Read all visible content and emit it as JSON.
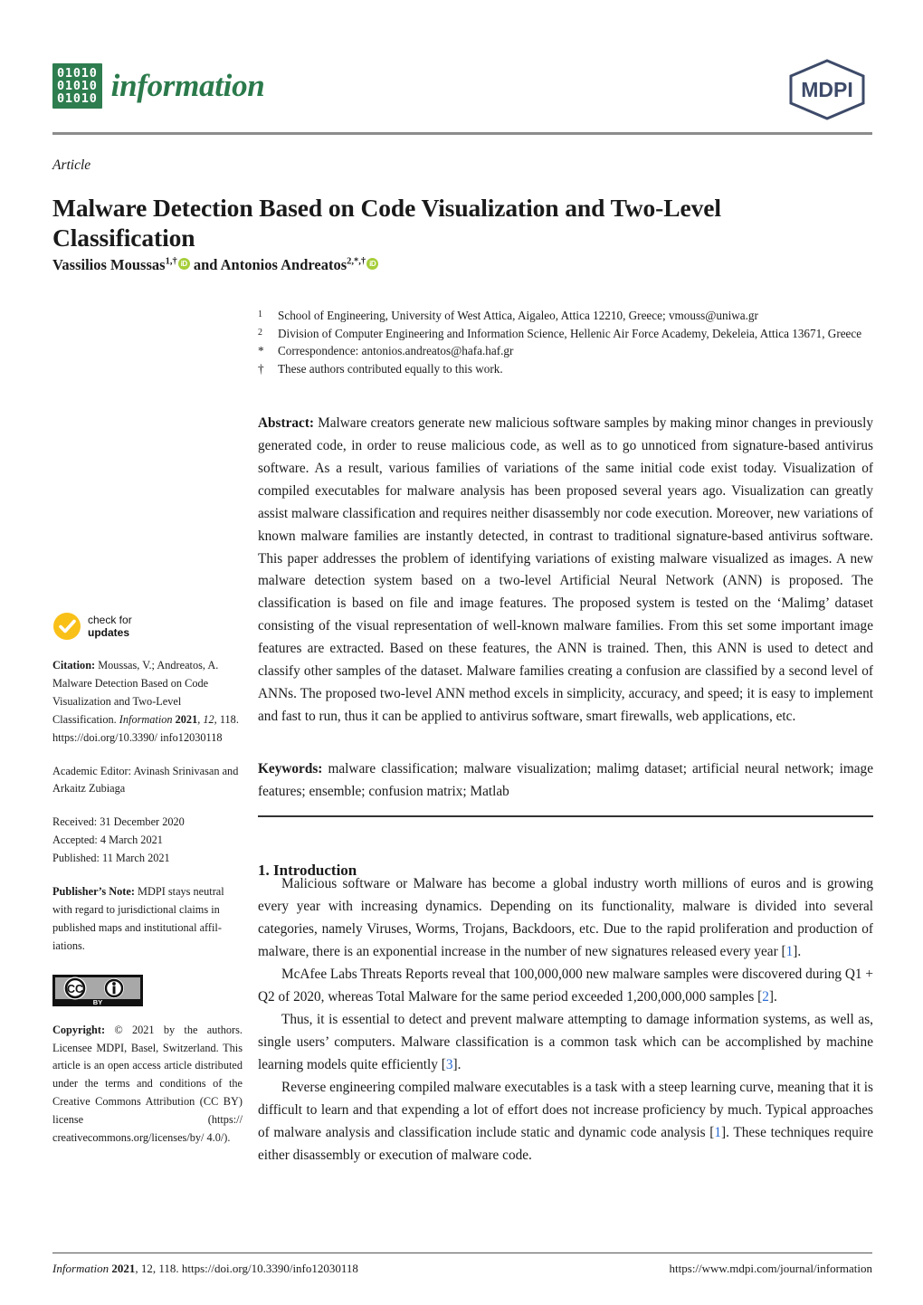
{
  "header": {
    "logo_binary_rows": [
      "01010",
      "01010",
      "01010"
    ],
    "journal_name": "information",
    "publisher_logo_text": "MDPI"
  },
  "article": {
    "kicker": "Article",
    "title": "Malware Detection Based on Code Visualization and Two-Level Classification",
    "authors_prefix": "Vassilios Moussas",
    "author1_sup": "1,†",
    "authors_conjunction": " and ",
    "author2": "Antonios Andreatos",
    "author2_sup": "2,*,†",
    "orcid_label": "iD"
  },
  "affiliations": [
    {
      "marker": "1",
      "text": "School of Engineering, University of West Attica, Aigaleo, Attica 12210, Greece; vmouss@uniwa.gr"
    },
    {
      "marker": "2",
      "text": "Division of Computer Engineering and Information Science, Hellenic Air Force Academy, Dekeleia, Attica 13671, Greece"
    },
    {
      "marker": "*",
      "text": "Correspondence: antonios.andreatos@hafa.haf.gr"
    },
    {
      "marker": "†",
      "text": "These authors contributed equally to this work."
    }
  ],
  "abstract": {
    "label": "Abstract:",
    "text": "Malware creators generate new malicious software samples by making minor changes in previously generated code, in order to reuse malicious code, as well as to go unnoticed from signature-based antivirus software. As a result, various families of variations of the same initial code exist today. Visualization of compiled executables for malware analysis has been proposed several years ago. Visualization can greatly assist malware classification and requires neither disassembly nor code execution. Moreover, new variations of known malware families are instantly detected, in contrast to traditional signature-based antivirus software. This paper addresses the problem of identifying variations of existing malware visualized as images. A new malware detection system based on a two-level Artificial Neural Network (ANN) is proposed. The classification is based on file and image features. The proposed system is tested on the ‘Malimg’ dataset consisting of the visual representation of well-known malware families. From this set some important image features are extracted. Based on these features, the ANN is trained. Then, this ANN is used to detect and classify other samples of the dataset. Malware families creating a confusion are classified by a second level of ANNs. The proposed two-level ANN method excels in simplicity, accuracy, and speed; it is easy to implement and fast to run, thus it can be applied to antivirus software, smart firewalls, web applications, etc."
  },
  "keywords": {
    "label": "Keywords:",
    "text": "malware classification; malware visualization; malimg dataset; artificial neural network; image features; ensemble; confusion matrix; Matlab"
  },
  "sidebar": {
    "check_updates_line1": "check for",
    "check_updates_line2": "updates",
    "citation_label": "Citation:",
    "citation_text_1": "Moussas, V.; Andreatos, A. Malware Detection Based on Code Visualization and Two-Level Classification. ",
    "citation_journal": "Information",
    "citation_year": "2021",
    "citation_volume": ", 12,",
    "citation_tail": " 118. https://doi.org/10.3390/ info12030118",
    "academic_editor": "Academic Editor: Avinash Srinivasan and Arkaitz Zubiaga",
    "received": "Received: 31 December 2020",
    "accepted": "Accepted: 4 March 2021",
    "published": "Published: 11 March 2021",
    "publisher_note_label": "Publisher’s Note:",
    "publisher_note_text": " MDPI stays neutral with regard to jurisdictional claims in published maps and institutional affil-iations.",
    "cc_badge_cc": "CC",
    "cc_badge_by": "BY",
    "copyright_label": "Copyright:",
    "copyright_text": " © 2021 by the authors. Licensee MDPI, Basel, Switzerland. This article is an open access article distributed under the terms and conditions of the Creative Commons Attribution (CC BY) license (https:// creativecommons.org/licenses/by/ 4.0/)."
  },
  "introduction": {
    "heading": "1. Introduction",
    "paragraphs": [
      {
        "parts": [
          {
            "t": "Malicious software or Malware has become a global industry worth millions of euros and is growing every year with increasing dynamics. Depending on its functionality, malware is divided into several categories, namely Viruses, Worms, Trojans, Backdoors, etc. Due to the rapid proliferation and production of malware, there is an exponential increase in the number of new signatures released every year ["
          },
          {
            "t": "1",
            "cite": true
          },
          {
            "t": "]."
          }
        ]
      },
      {
        "parts": [
          {
            "t": "McAfee Labs Threats Reports reveal that 100,000,000 new malware samples were discovered during Q1 + Q2 of 2020, whereas Total Malware for the same period exceeded 1,200,000,000 samples ["
          },
          {
            "t": "2",
            "cite": true
          },
          {
            "t": "]."
          }
        ]
      },
      {
        "parts": [
          {
            "t": "Thus, it is essential to detect and prevent malware attempting to damage information systems, as well as, single users’ computers. Malware classification is a common task which can be accomplished by machine learning models quite efficiently ["
          },
          {
            "t": "3",
            "cite": true
          },
          {
            "t": "]."
          }
        ]
      },
      {
        "parts": [
          {
            "t": "Reverse engineering compiled malware executables is a task with a steep learning curve, meaning that it is difficult to learn and that expending a lot of effort does not increase proficiency by much. Typical approaches of malware analysis and classification include static and dynamic code analysis ["
          },
          {
            "t": "1",
            "cite": true
          },
          {
            "t": "]. These techniques require either disassembly or execution of malware code."
          }
        ]
      }
    ]
  },
  "footer": {
    "left_journal": "Information",
    "left_year": "2021",
    "left_rest": ", 12, 118. https://doi.org/10.3390/info12030118",
    "right": "https://www.mdpi.com/journal/information"
  },
  "colors": {
    "journal_green": "#2b7a4b",
    "mdpi_navy": "#3d4a69",
    "orcid_green": "#a6ce39",
    "check_yellow": "#f9c018",
    "citation_blue": "#2b6cd4"
  }
}
